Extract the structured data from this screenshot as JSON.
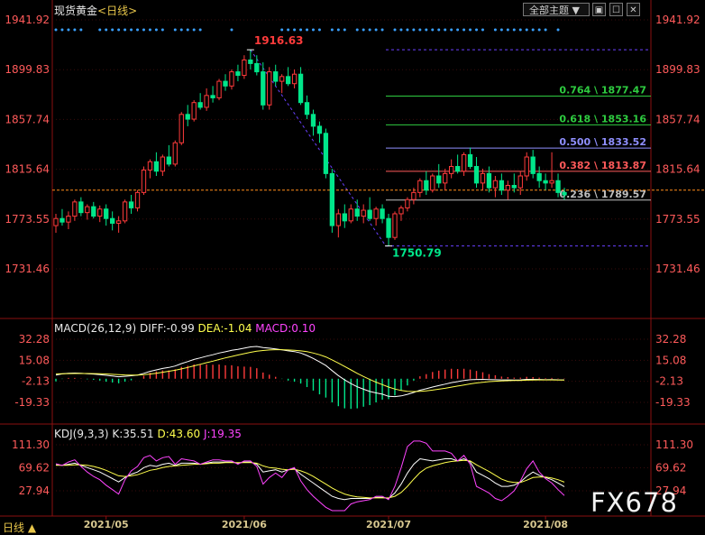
{
  "header": {
    "instrument": "现货黄金",
    "period_open": "<",
    "period": "日线",
    "period_close": ">",
    "theme_label": "全部主题",
    "theme_arrow": "▼",
    "window_icons": [
      "restore-icon",
      "minimize-icon",
      "close-icon"
    ],
    "window_glyphs": [
      "▣",
      "☐",
      "✕"
    ]
  },
  "macd": {
    "title": "MACD(26,12,9)",
    "diff_label": "DIFF:-0.99",
    "dea_label": "DEA:-1.04",
    "macd_label": "MACD:0.10"
  },
  "kdj": {
    "title": "KDJ(9,3,3)",
    "k_label": "K:35.51",
    "d_label": "D:43.60",
    "j_label": "J:19.35"
  },
  "footer": {
    "tab": "日线 ▲",
    "watermark": "FX678"
  },
  "colors": {
    "up": "#ff3b3b",
    "down": "#00e68a",
    "k": "#ffffff",
    "d": "#ffff4d",
    "j": "#ff44ff",
    "axis_red": "#ff5a5a",
    "fib_green": "#2ecc40",
    "fib_blue": "#8f8fff",
    "fib_red": "#ff5a5a",
    "fib_gray": "#bfbfbf",
    "purple_dash": "#6a40ff",
    "orange": "#ff8c1a",
    "marker_blue": "#3aa0ff"
  },
  "chart_data": [
    {
      "type": "candlestick",
      "title": "现货黄金 日线",
      "y_ticks": [
        "1941.92",
        "1899.83",
        "1857.74",
        "1815.64",
        "1773.55",
        "1731.46"
      ],
      "ylim": [
        1731.46,
        1941.92
      ],
      "x_ticks": [
        "2021/05",
        "2021/06",
        "2021/07",
        "2021/08"
      ],
      "high_label": "1916.63",
      "low_label": "1750.79",
      "current_price_line": 1798,
      "fibonacci": [
        {
          "ratio": "0.764",
          "price": "1877.47",
          "label": "0.764 \\ 1877.47",
          "color": "#2ecc40"
        },
        {
          "ratio": "0.618",
          "price": "1853.16",
          "label": "0.618 \\ 1853.16",
          "color": "#2ecc40"
        },
        {
          "ratio": "0.500",
          "price": "1833.52",
          "label": "0.500 \\ 1833.52",
          "color": "#8f8fff"
        },
        {
          "ratio": "0.382",
          "price": "1813.87",
          "label": "0.382 \\ 1813.87",
          "color": "#ff5a5a"
        },
        {
          "ratio": "0.236",
          "price": "1789.57",
          "label": "0.236 \\ 1789.57",
          "color": "#bfbfbf"
        }
      ],
      "candles": [
        [
          1768,
          1778,
          1762,
          1774
        ],
        [
          1774,
          1782,
          1768,
          1771
        ],
        [
          1771,
          1780,
          1765,
          1776
        ],
        [
          1776,
          1790,
          1772,
          1788
        ],
        [
          1788,
          1792,
          1776,
          1779
        ],
        [
          1779,
          1786,
          1773,
          1784
        ],
        [
          1784,
          1788,
          1774,
          1776
        ],
        [
          1776,
          1785,
          1771,
          1782
        ],
        [
          1782,
          1786,
          1768,
          1774
        ],
        [
          1774,
          1780,
          1764,
          1770
        ],
        [
          1770,
          1776,
          1762,
          1772
        ],
        [
          1772,
          1790,
          1770,
          1788
        ],
        [
          1788,
          1794,
          1778,
          1783
        ],
        [
          1783,
          1798,
          1780,
          1796
        ],
        [
          1796,
          1818,
          1794,
          1815
        ],
        [
          1815,
          1824,
          1808,
          1822
        ],
        [
          1822,
          1830,
          1810,
          1814
        ],
        [
          1814,
          1828,
          1810,
          1826
        ],
        [
          1826,
          1836,
          1818,
          1820
        ],
        [
          1820,
          1840,
          1818,
          1838
        ],
        [
          1838,
          1864,
          1836,
          1862
        ],
        [
          1862,
          1870,
          1852,
          1858
        ],
        [
          1858,
          1874,
          1856,
          1872
        ],
        [
          1872,
          1880,
          1866,
          1868
        ],
        [
          1868,
          1884,
          1865,
          1878
        ],
        [
          1878,
          1886,
          1872,
          1876
        ],
        [
          1876,
          1892,
          1874,
          1890
        ],
        [
          1890,
          1896,
          1882,
          1886
        ],
        [
          1886,
          1900,
          1883,
          1898
        ],
        [
          1898,
          1904,
          1890,
          1895
        ],
        [
          1895,
          1912,
          1892,
          1908
        ],
        [
          1908,
          1916.63,
          1900,
          1905
        ],
        [
          1905,
          1912,
          1895,
          1898
        ],
        [
          1898,
          1906,
          1866,
          1870
        ],
        [
          1870,
          1902,
          1866,
          1898
        ],
        [
          1898,
          1904,
          1886,
          1890
        ],
        [
          1890,
          1896,
          1880,
          1894
        ],
        [
          1894,
          1902,
          1886,
          1888
        ],
        [
          1888,
          1900,
          1884,
          1896
        ],
        [
          1896,
          1902,
          1870,
          1872
        ],
        [
          1872,
          1878,
          1858,
          1862
        ],
        [
          1862,
          1866,
          1844,
          1852
        ],
        [
          1852,
          1856,
          1838,
          1846
        ],
        [
          1846,
          1850,
          1808,
          1812
        ],
        [
          1812,
          1816,
          1762,
          1768
        ],
        [
          1768,
          1782,
          1758,
          1778
        ],
        [
          1778,
          1786,
          1766,
          1772
        ],
        [
          1772,
          1786,
          1770,
          1782
        ],
        [
          1782,
          1790,
          1772,
          1776
        ],
        [
          1776,
          1786,
          1770,
          1781
        ],
        [
          1781,
          1792,
          1772,
          1774
        ],
        [
          1774,
          1784,
          1768,
          1782
        ],
        [
          1782,
          1786,
          1770,
          1774
        ],
        [
          1774,
          1778,
          1750.79,
          1758
        ],
        [
          1758,
          1780,
          1756,
          1778
        ],
        [
          1778,
          1785,
          1772,
          1783
        ],
        [
          1783,
          1792,
          1780,
          1790
        ],
        [
          1790,
          1800,
          1786,
          1796
        ],
        [
          1796,
          1808,
          1792,
          1806
        ],
        [
          1806,
          1814,
          1794,
          1798
        ],
        [
          1798,
          1812,
          1796,
          1810
        ],
        [
          1810,
          1820,
          1800,
          1804
        ],
        [
          1804,
          1816,
          1798,
          1812
        ],
        [
          1812,
          1824,
          1808,
          1818
        ],
        [
          1818,
          1828,
          1812,
          1814
        ],
        [
          1814,
          1830,
          1810,
          1828
        ],
        [
          1828,
          1834,
          1816,
          1818
        ],
        [
          1818,
          1826,
          1800,
          1804
        ],
        [
          1804,
          1816,
          1798,
          1812
        ],
        [
          1812,
          1818,
          1796,
          1800
        ],
        [
          1800,
          1810,
          1792,
          1806
        ],
        [
          1806,
          1812,
          1794,
          1798
        ],
        [
          1798,
          1806,
          1790,
          1802
        ],
        [
          1802,
          1812,
          1796,
          1800
        ],
        [
          1800,
          1814,
          1794,
          1810
        ],
        [
          1810,
          1830,
          1806,
          1826
        ],
        [
          1826,
          1832,
          1808,
          1812
        ],
        [
          1812,
          1818,
          1800,
          1806
        ],
        [
          1806,
          1812,
          1798,
          1804
        ],
        [
          1804,
          1830,
          1800,
          1806
        ],
        [
          1806,
          1812,
          1792,
          1796
        ],
        [
          1796,
          1800,
          1790,
          1794
        ]
      ]
    },
    {
      "type": "macd",
      "title": "MACD(26,12,9)",
      "y_ticks": [
        "32.28",
        "15.08",
        "-2.13",
        "-19.33"
      ],
      "ylim": [
        -19.33,
        32.28
      ],
      "diff": [
        3,
        4,
        4.5,
        4.6,
        4.4,
        4.1,
        3.8,
        3.4,
        2.8,
        2.2,
        1.6,
        2.0,
        2.4,
        3.0,
        4.4,
        6,
        7.2,
        8.4,
        9.2,
        10.4,
        12.4,
        14,
        15.8,
        17,
        18.4,
        19.6,
        21,
        22,
        23.2,
        24,
        25,
        26,
        26.4,
        25.4,
        25,
        24.4,
        23.6,
        22.8,
        22.2,
        21,
        19,
        16.6,
        13.8,
        10.8,
        6.6,
        2.6,
        -1,
        -4,
        -6.6,
        -8.6,
        -10.4,
        -11.6,
        -12.6,
        -14.4,
        -14.6,
        -14,
        -12.8,
        -11.2,
        -9.4,
        -8.2,
        -6.8,
        -5.6,
        -4.4,
        -3.2,
        -2.4,
        -1.4,
        -0.8,
        -0.6,
        -0.5,
        -0.7,
        -0.8,
        -1,
        -1,
        -1.1,
        -1,
        -0.5,
        -0.5,
        -0.6,
        -0.8,
        -0.7,
        -0.9,
        -0.99
      ],
      "dea": [
        4,
        4.1,
        4.2,
        4.3,
        4.3,
        4.3,
        4.2,
        4.1,
        3.9,
        3.6,
        3.3,
        3.1,
        3.0,
        3.0,
        3.3,
        3.8,
        4.5,
        5.3,
        6.1,
        6.9,
        8,
        9.2,
        10.5,
        11.8,
        13.1,
        14.4,
        15.7,
        17,
        18.2,
        19.4,
        20.5,
        21.6,
        22.5,
        23.1,
        23.5,
        23.7,
        23.7,
        23.5,
        23.3,
        22.8,
        22.1,
        21,
        19.6,
        17.8,
        15.4,
        12.8,
        10,
        7.2,
        4.4,
        1.8,
        -0.6,
        -2.8,
        -4.8,
        -6.8,
        -8.4,
        -9.6,
        -10.3,
        -10.5,
        -10.3,
        -9.9,
        -9.3,
        -8.6,
        -7.8,
        -6.9,
        -6,
        -5.1,
        -4.2,
        -3.5,
        -2.9,
        -2.4,
        -2.1,
        -1.8,
        -1.6,
        -1.5,
        -1.4,
        -1.2,
        -1.1,
        -1.0,
        -1.0,
        -1.0,
        -1.02,
        -1.04
      ],
      "macd": [
        -1,
        -0.1,
        0.3,
        0.3,
        0.1,
        -0.2,
        -0.4,
        -0.7,
        -1.1,
        -1.4,
        -1.7,
        -1.1,
        -0.6,
        0,
        1.1,
        2.2,
        2.7,
        3.1,
        3.1,
        3.5,
        4.4,
        4.8,
        5.3,
        5.2,
        5.3,
        5.2,
        5.3,
        5,
        5,
        4.6,
        4.5,
        4.4,
        3.9,
        2.3,
        1.5,
        0.7,
        -0.1,
        -0.7,
        -1.1,
        -1.8,
        -3.1,
        -4.4,
        -5.8,
        -7,
        -8.8,
        -10.2,
        -11,
        -11.2,
        -11,
        -10.4,
        -9.8,
        -8.8,
        -7.8,
        -7.6,
        -6.2,
        -4.4,
        -2.5,
        -0.7,
        0.9,
        1.7,
        2.5,
        3,
        3.4,
        3.7,
        3.6,
        3.7,
        3.4,
        2.9,
        2.4,
        1.7,
        1.3,
        0.8,
        0.6,
        0.4,
        0.4,
        0.7,
        0.6,
        0.4,
        0.2,
        0.3,
        0.12,
        0.1
      ]
    },
    {
      "type": "kdj",
      "title": "KDJ(9,3,3)",
      "y_ticks": [
        "111.30",
        "69.62",
        "27.94"
      ],
      "ylim": [
        27.94,
        111.3
      ],
      "k": [
        75,
        74,
        76,
        78,
        74,
        70,
        66,
        62,
        56,
        50,
        44,
        52,
        58,
        62,
        70,
        74,
        72,
        76,
        78,
        74,
        78,
        78,
        78,
        76,
        78,
        80,
        80,
        80,
        80,
        78,
        80,
        80,
        76,
        62,
        64,
        66,
        62,
        66,
        68,
        58,
        50,
        42,
        34,
        26,
        18,
        14,
        12,
        14,
        14,
        14,
        14,
        16,
        16,
        14,
        24,
        40,
        60,
        76,
        86,
        84,
        82,
        84,
        86,
        86,
        82,
        86,
        80,
        62,
        56,
        50,
        42,
        36,
        36,
        38,
        44,
        54,
        62,
        56,
        52,
        48,
        42,
        35.51
      ],
      "d": [
        74,
        74,
        74,
        75,
        75,
        74,
        72,
        69,
        65,
        60,
        55,
        54,
        55,
        57,
        61,
        65,
        67,
        70,
        72,
        73,
        74,
        75,
        76,
        76,
        77,
        78,
        78,
        79,
        79,
        79,
        79,
        79,
        78,
        73,
        70,
        69,
        67,
        66,
        67,
        64,
        60,
        54,
        47,
        40,
        33,
        27,
        22,
        19,
        17,
        16,
        15,
        15,
        15,
        15,
        18,
        25,
        36,
        49,
        61,
        69,
        73,
        76,
        79,
        81,
        82,
        83,
        82,
        75,
        69,
        63,
        56,
        49,
        45,
        43,
        43,
        47,
        52,
        53,
        53,
        51,
        48,
        43.6
      ],
      "j": [
        77,
        74,
        80,
        84,
        72,
        62,
        54,
        48,
        38,
        30,
        22,
        48,
        64,
        72,
        88,
        92,
        82,
        88,
        90,
        76,
        86,
        84,
        82,
        76,
        80,
        84,
        84,
        82,
        82,
        76,
        82,
        82,
        72,
        40,
        52,
        60,
        52,
        66,
        70,
        46,
        30,
        18,
        8,
        -2,
        -12,
        -12,
        -8,
        4,
        8,
        10,
        12,
        18,
        18,
        12,
        36,
        70,
        108,
        130,
        136,
        114,
        100,
        100,
        100,
        96,
        82,
        92,
        76,
        36,
        30,
        24,
        14,
        10,
        18,
        28,
        46,
        68,
        82,
        62,
        50,
        42,
        30,
        19.35
      ]
    }
  ]
}
